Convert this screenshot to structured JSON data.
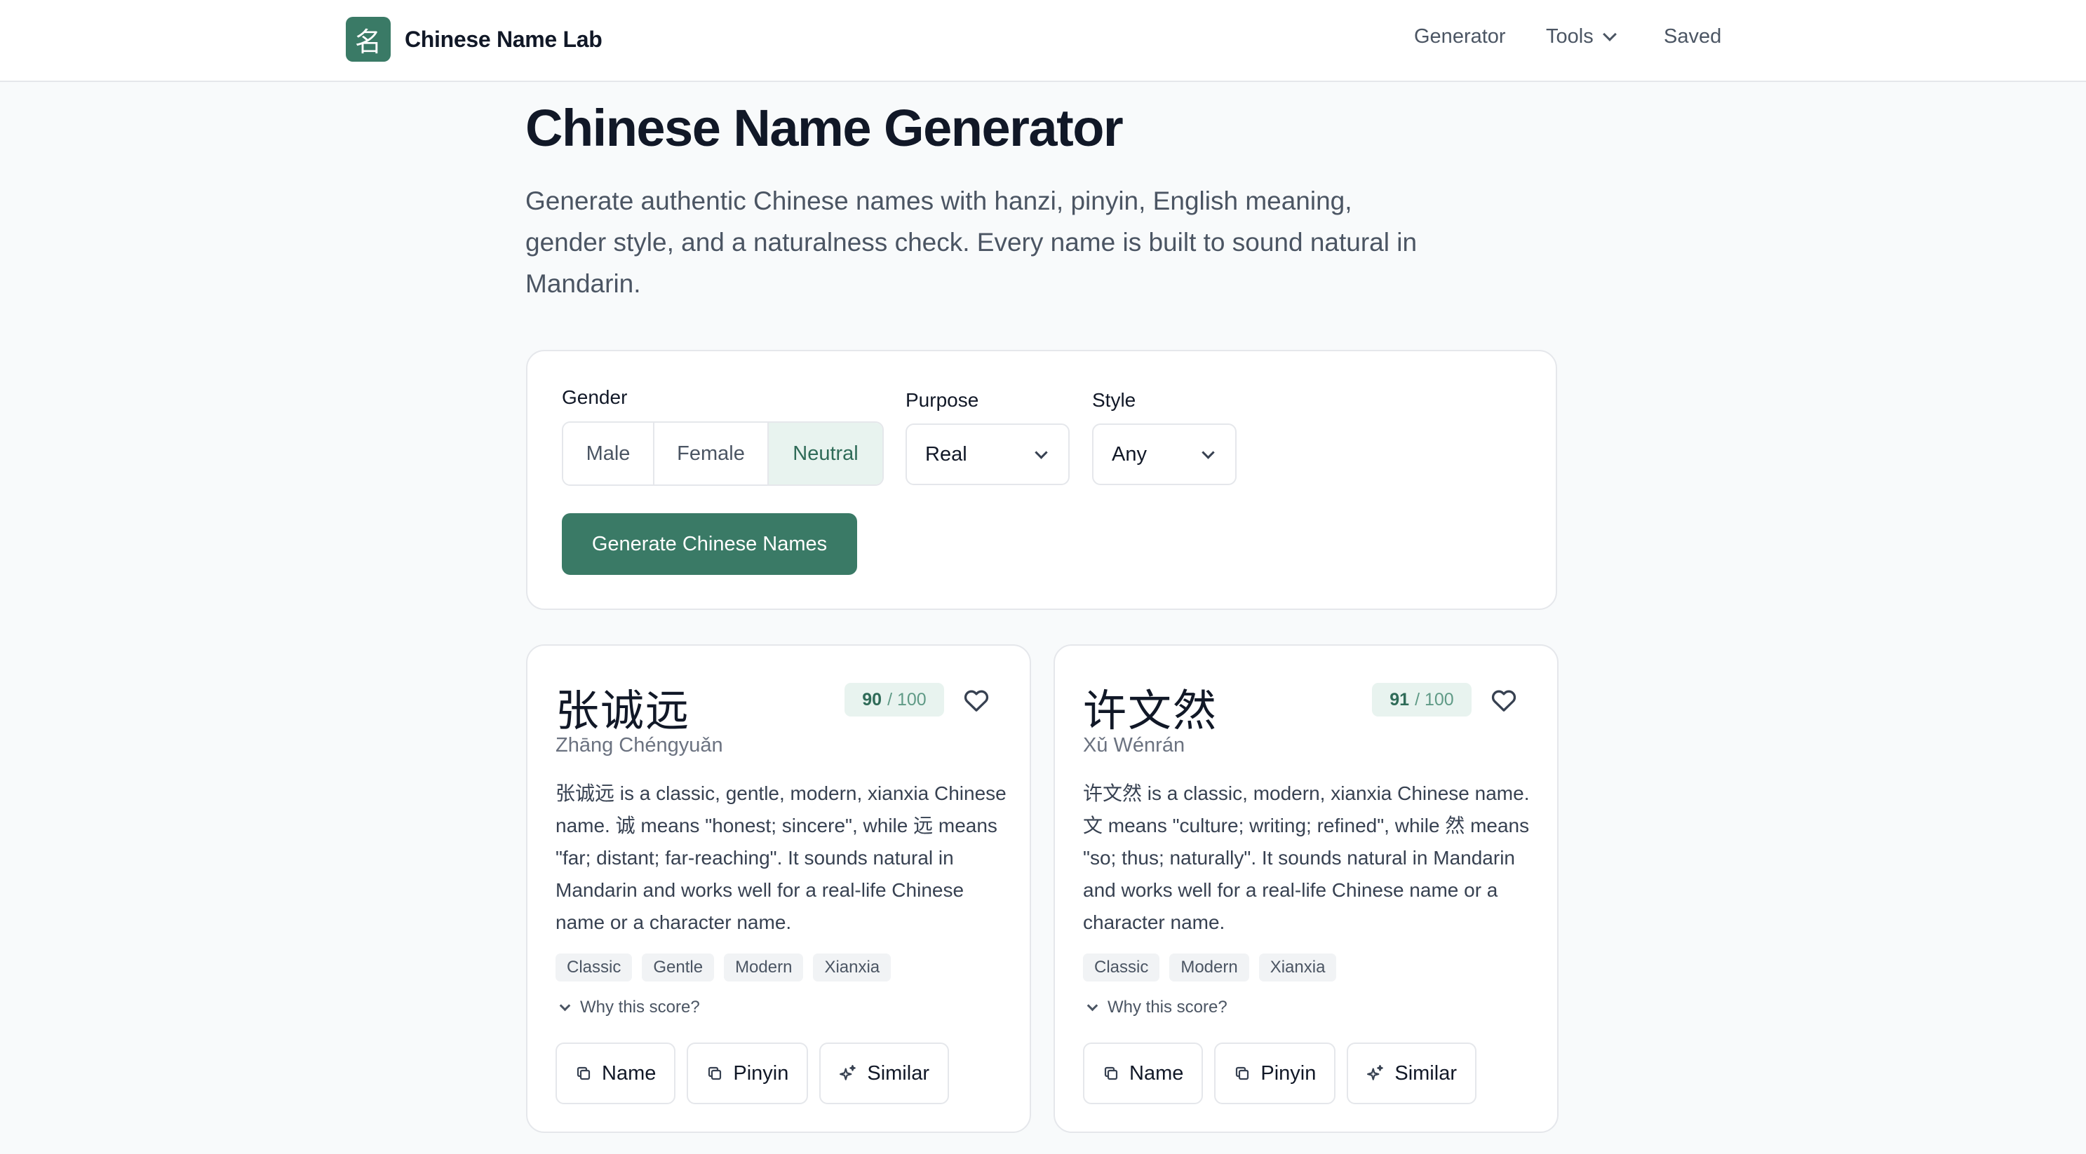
{
  "header": {
    "logo_glyph": "名",
    "brand": "Chinese Name Lab",
    "nav": {
      "generator": "Generator",
      "tools": "Tools",
      "saved": "Saved"
    }
  },
  "hero": {
    "title": "Chinese Name Generator",
    "subtitle": "Generate authentic Chinese names with hanzi, pinyin, English meaning, gender style, and a naturalness check. Every name is built to sound natural in Mandarin."
  },
  "form": {
    "gender_label": "Gender",
    "gender_options": [
      "Male",
      "Female",
      "Neutral"
    ],
    "gender_selected": "Neutral",
    "purpose_label": "Purpose",
    "purpose_value": "Real",
    "style_label": "Style",
    "style_value": "Any",
    "generate_label": "Generate Chinese Names"
  },
  "results": [
    {
      "hanzi": "张诚远",
      "pinyin": "Zhāng Chéngyuǎn",
      "score": "90",
      "score_max": "/ 100",
      "description": "张诚远 is a classic, gentle, modern, xianxia Chinese name. 诚 means \"honest; sincere\", while 远 means \"far; distant; far-reaching\". It sounds natural in Mandarin and works well for a real-life Chinese name or a character name.",
      "tags": [
        "Classic",
        "Gentle",
        "Modern",
        "Xianxia"
      ],
      "why": "Why this score?",
      "actions": {
        "name": "Name",
        "pinyin": "Pinyin",
        "similar": "Similar"
      }
    },
    {
      "hanzi": "许文然",
      "pinyin": "Xǔ Wénrán",
      "score": "91",
      "score_max": "/ 100",
      "description": "许文然 is a classic, modern, xianxia Chinese name. 文 means \"culture; writing; refined\", while 然 means \"so; thus; naturally\". It sounds natural in Mandarin and works well for a real-life Chinese name or a character name.",
      "tags": [
        "Classic",
        "Modern",
        "Xianxia"
      ],
      "why": "Why this score?",
      "actions": {
        "name": "Name",
        "pinyin": "Pinyin",
        "similar": "Similar"
      }
    }
  ],
  "colors": {
    "accent": "#3a7a66",
    "accent_light": "#e8f3ef",
    "border": "#e5e7eb"
  }
}
